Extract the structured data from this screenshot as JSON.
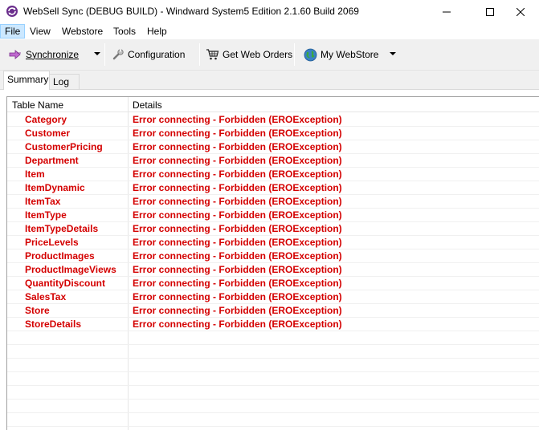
{
  "window": {
    "title": "WebSell Sync (DEBUG BUILD) - Windward System5 Edition 2.1.60 Build 2069"
  },
  "menu": {
    "items": [
      {
        "label": "File",
        "active": true
      },
      {
        "label": "View"
      },
      {
        "label": "Webstore"
      },
      {
        "label": "Tools"
      },
      {
        "label": "Help"
      }
    ]
  },
  "toolbar": {
    "synchronize_label": "Synchronize",
    "configuration_label": "Configuration",
    "get_web_orders_label": "Get Web Orders",
    "my_webstore_label": "My WebStore"
  },
  "tabs": {
    "summary_label": "Summary",
    "log_label": "Log"
  },
  "grid": {
    "columns": [
      "Table Name",
      "Details"
    ],
    "rows": [
      {
        "name": "Category",
        "details": "Error connecting - Forbidden (EROException)"
      },
      {
        "name": "Customer",
        "details": "Error connecting - Forbidden (EROException)"
      },
      {
        "name": "CustomerPricing",
        "details": "Error connecting - Forbidden (EROException)"
      },
      {
        "name": "Department",
        "details": "Error connecting - Forbidden (EROException)"
      },
      {
        "name": "Item",
        "details": "Error connecting - Forbidden (EROException)"
      },
      {
        "name": "ItemDynamic",
        "details": "Error connecting - Forbidden (EROException)"
      },
      {
        "name": "ItemTax",
        "details": "Error connecting - Forbidden (EROException)"
      },
      {
        "name": "ItemType",
        "details": "Error connecting - Forbidden (EROException)"
      },
      {
        "name": "ItemTypeDetails",
        "details": "Error connecting - Forbidden (EROException)"
      },
      {
        "name": "PriceLevels",
        "details": "Error connecting - Forbidden (EROException)"
      },
      {
        "name": "ProductImages",
        "details": "Error connecting - Forbidden (EROException)"
      },
      {
        "name": "ProductImageViews",
        "details": "Error connecting - Forbidden (EROException)"
      },
      {
        "name": "QuantityDiscount",
        "details": "Error connecting - Forbidden (EROException)"
      },
      {
        "name": "SalesTax",
        "details": "Error connecting - Forbidden (EROException)"
      },
      {
        "name": "Store",
        "details": "Error connecting - Forbidden (EROException)"
      },
      {
        "name": "StoreDetails",
        "details": "Error connecting - Forbidden (EROException)"
      }
    ]
  },
  "colors": {
    "error_text": "#d40000",
    "menu_active": "#cce8ff"
  },
  "icons": {
    "app": "sync-app-icon",
    "synchronize": "sync-icon",
    "configuration": "wrench-icon",
    "get_web_orders": "cart-icon",
    "my_webstore": "globe-icon"
  }
}
